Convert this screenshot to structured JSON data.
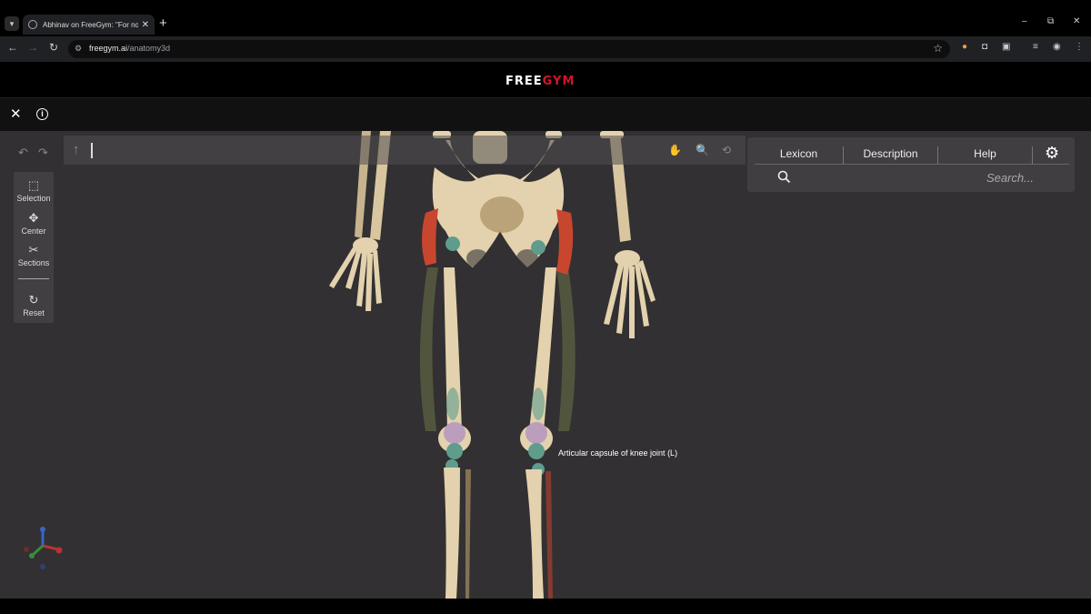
{
  "browser": {
    "tab_title": "Abhinav on FreeGym: \"For now",
    "tab_close": "✕",
    "new_tab": "+",
    "url_host": "freegym.ai",
    "url_path": "/anatomy3d",
    "window_controls": [
      "–",
      "⧉",
      "✕"
    ]
  },
  "app": {
    "logo_free": "FREE",
    "logo_gym": "GYM",
    "close_symbol": "✕",
    "info_symbol": "i"
  },
  "tools": {
    "items": [
      {
        "label": "Selection",
        "icon": "selection-icon"
      },
      {
        "label": "Center",
        "icon": "center-icon"
      },
      {
        "label": "Sections",
        "icon": "sections-icon"
      },
      {
        "label": "Reset",
        "icon": "reset-icon"
      }
    ]
  },
  "panel": {
    "tabs": [
      "Lexicon",
      "Description",
      "Help"
    ],
    "search_placeholder": "Search..."
  },
  "viewer": {
    "hover_label": "Articular capsule of knee joint (L)"
  },
  "colors": {
    "brand_red": "#d4142a",
    "viewport_bg": "#323032",
    "bone": "#e3d2ad",
    "muscle": "#c8462e",
    "cartilage": "#5f9c8c",
    "capsule": "#b494c0"
  }
}
